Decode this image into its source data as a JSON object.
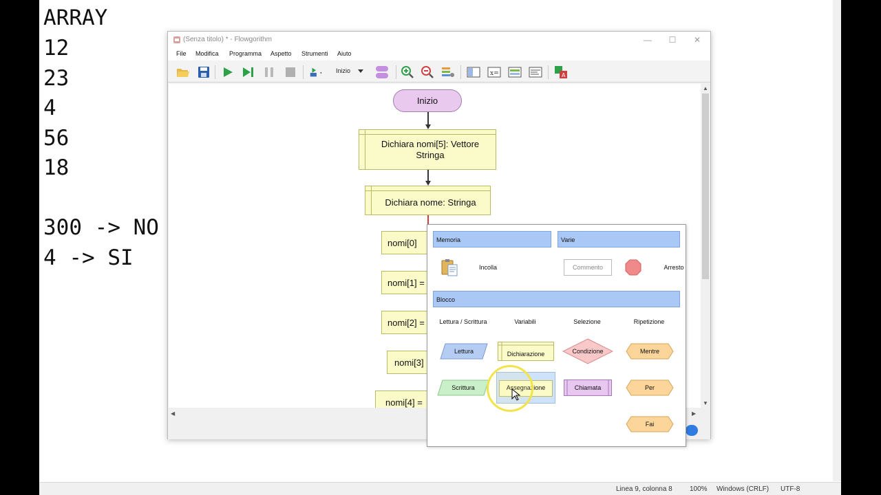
{
  "notepad": {
    "lines": [
      "ARRAY",
      "12",
      "23",
      "4",
      "56",
      "18",
      "",
      "300 -> NO",
      "4 -> SI"
    ],
    "status": {
      "position": "Linea 9, colonna 8",
      "zoom": "100%",
      "eol": "Windows (CRLF)",
      "encoding": "UTF-8"
    }
  },
  "window": {
    "title": "(Senza titolo) * - Flowgorithm",
    "minimize": "—",
    "maximize": "☐",
    "close": "✕"
  },
  "menu": [
    "File",
    "Modifica",
    "Programma",
    "Aspetto",
    "Strumenti",
    "Aiuto"
  ],
  "toolbar": {
    "level_label": "Inizio"
  },
  "flowchart": {
    "start": "Inizio",
    "declare_array": "Dichiara nomi[5]: Vettore Stringa",
    "declare_name": "Dichiara nome: Stringa",
    "assignments": [
      "nomi[0]",
      "nomi[1] =",
      "nomi[2] =",
      "nomi[3]",
      "nomi[4] ="
    ]
  },
  "popup": {
    "memory_header": "Memoria",
    "misc_header": "Varie",
    "paste": "Incolla",
    "comment": "Commento",
    "stop": "Arresto",
    "block_header": "Blocco",
    "columns": [
      "Lettura / Scrittura",
      "Variabili",
      "Selezione",
      "Ripetizione"
    ],
    "read": "Lettura",
    "write": "Scrittura",
    "declaration": "Dichiarazione",
    "assignment": "Assegnazione",
    "condition": "Condizione",
    "call": "Chiamata",
    "while": "Mentre",
    "for": "Per",
    "do": "Fai"
  },
  "colors": {
    "start_fill": "#e9c9ee",
    "decl_fill": "#fbfbc9",
    "header_fill": "#a9c8f5",
    "highlight": "#f1e34a"
  }
}
